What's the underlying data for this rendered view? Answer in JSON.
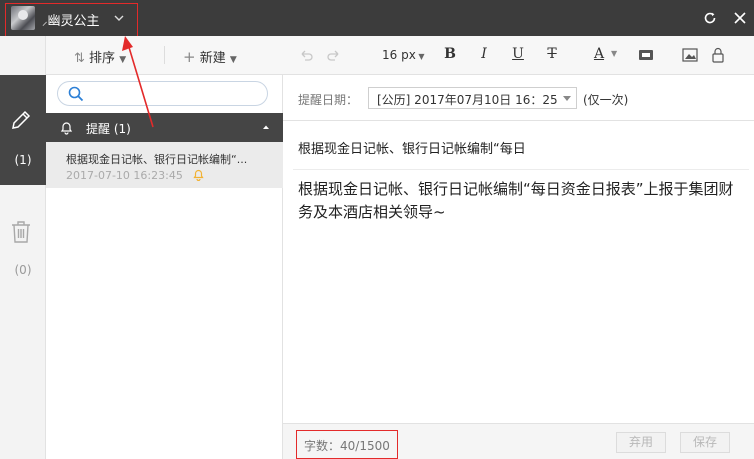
{
  "titlebar": {
    "username": "幽灵公主",
    "refresh_icon": "refresh-icon",
    "close_icon": "close-icon"
  },
  "rail": {
    "notes_count": "(1)",
    "trash_count": "(0)"
  },
  "list": {
    "sort_label": "排序",
    "new_label": "新建",
    "search_placeholder": "",
    "group_label": "提醒 (1)",
    "note": {
      "title": "根据现金日记帐、银行日记帐编制“...",
      "time": "2017-07-10 16:23:45"
    }
  },
  "editor": {
    "font_size": "16 px",
    "reminder_label": "提醒日期：",
    "reminder_date": "[公历] 2017年07月10日   16：25",
    "reminder_repeat": "(仅一次)",
    "title": "根据现金日记帐、银行日记帐编制“每日",
    "body": "根据现金日记帐、银行日记帐编制“每日资金日报表”上报于集团财务及本酒店相关领导~",
    "word_count": "字数：40/1500",
    "discard_label": "弃用",
    "save_label": "保存"
  },
  "colors": {
    "titlebar_bg": "#3c3c3c",
    "dark_panel": "#454545",
    "annotation_red": "#e32a2a",
    "bell": "#f2b233"
  }
}
